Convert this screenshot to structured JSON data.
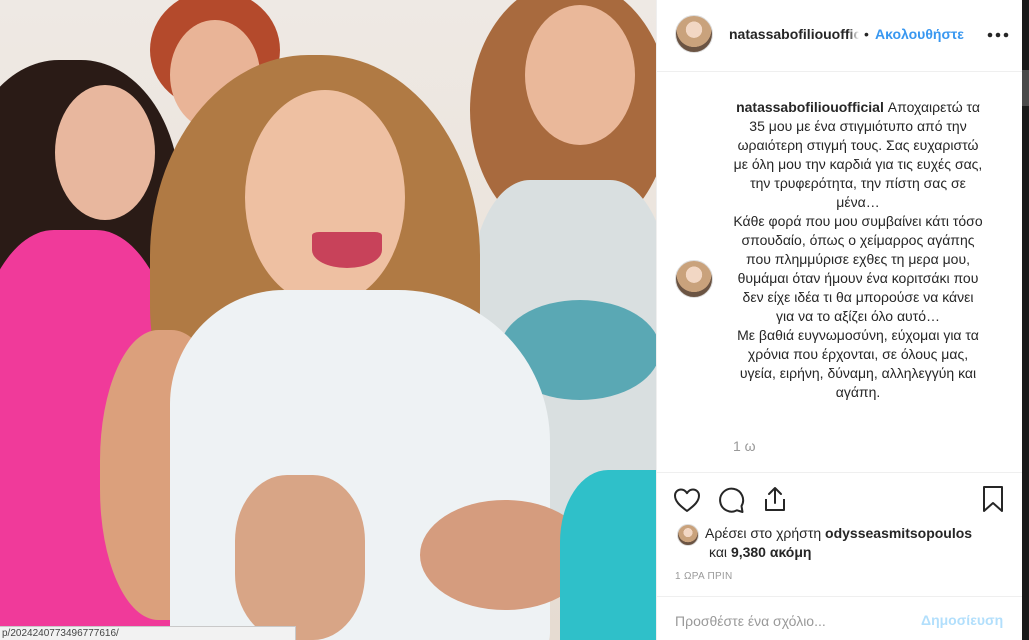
{
  "status_bar": {
    "url": "p/2024240773496777616/"
  },
  "post": {
    "author": {
      "username": "natassabofiliouofficial",
      "separator": "•",
      "follow_label": "Ακολουθήστε",
      "more_label": "•••"
    },
    "caption": {
      "username": "natassabofiliouofficial",
      "text": "Αποχαιρετώ τα 35 μου με ένα στιγμιότυπο από την ωραιότερη στιγμή τους. Σας ευχαριστώ με όλη μου την καρδιά για τις ευχές σας, την τρυφερότητα, την πίστη σας σε μένα…\nΚάθε φορά που μου συμβαίνει κάτι τόσο σπουδαίο, όπως ο χείμαρρος αγάπης που πλημμύρισε εχθες τη μερα μου, θυμάμαι όταν ήμουν ένα κοριτσάκι που δεν είχε ιδέα τι θα μπορούσε να κάνει για να το αξίζει όλο αυτό…\nΜε βαθιά ευγνωμοσύνη, εύχομαι για τα χρόνια που έρχονται, σε όλους μας, υγεία, ειρήνη, δύναμη, αλληλεγγύη και αγάπη.",
      "time": "1 ω"
    },
    "actions": {
      "like_icon": "heart-icon",
      "comment_icon": "comment-icon",
      "share_icon": "share-icon",
      "save_icon": "bookmark-icon"
    },
    "likes": {
      "prefix": "Αρέσει στο χρήστη ",
      "liker": "odysseasmitsopoulos",
      "conjunction": "και ",
      "others": "9,380 ακόμη"
    },
    "posted_ago": "1 ΩΡΑ ΠΡΙΝ",
    "comment": {
      "placeholder": "Προσθέστε ένα σχόλιο...",
      "post_label": "Δημοσίευση"
    }
  },
  "colors": {
    "link_blue": "#3897f0",
    "post_disabled": "#b2dffc",
    "text": "#262626",
    "muted": "#999999",
    "border": "#efefef"
  }
}
